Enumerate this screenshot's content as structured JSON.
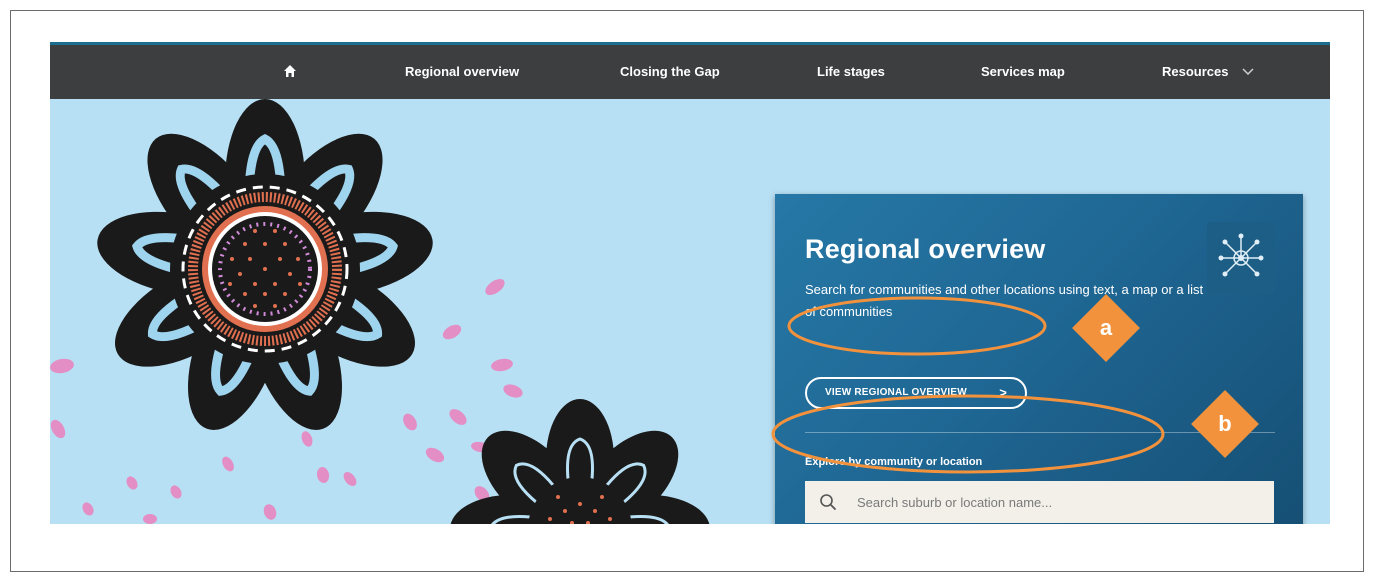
{
  "nav": {
    "home_icon": "home-icon",
    "items": [
      "Regional overview",
      "Closing the Gap",
      "Life stages",
      "Services map",
      "Resources"
    ],
    "resources_chevron": "chevron-down-icon"
  },
  "card": {
    "title": "Regional overview",
    "description": "Search for communities and other locations using text, a map or a list of communities",
    "icon": "network-icon",
    "button_label": "VIEW REGIONAL OVERVIEW",
    "button_chevron": ">",
    "explore_label": "Explore by community or location",
    "search_placeholder": "Search suburb or location name..."
  },
  "annotations": [
    {
      "letter": "a",
      "target": "view-regional-overview-button"
    },
    {
      "letter": "b",
      "target": "explore-search"
    }
  ],
  "colors": {
    "nav_bg": "#3d3e40",
    "hero_bg": "#b8e0f4",
    "card_bg": "#1f6794",
    "annotation_orange": "#f2923d"
  }
}
